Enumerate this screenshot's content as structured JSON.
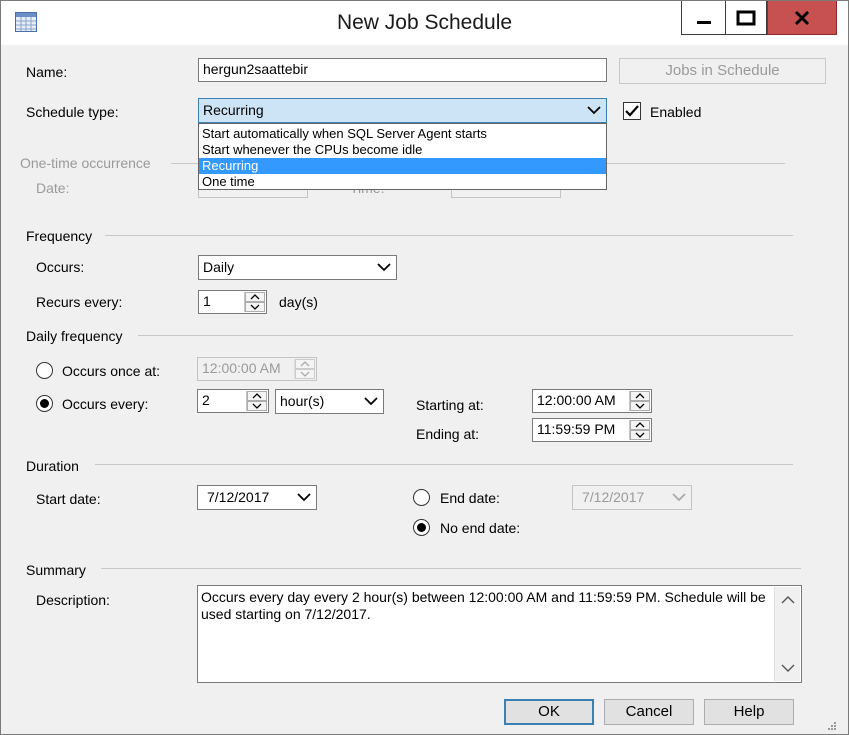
{
  "window": {
    "title": "New Job Schedule",
    "icons": {
      "app": "calendar-grid-icon",
      "minimize": "minimize-icon",
      "maximize": "maximize-icon",
      "close": "close-icon"
    }
  },
  "name": {
    "label": "Name:",
    "value": "hergun2saattebir"
  },
  "jobs_button": "Jobs in Schedule",
  "schedule_type": {
    "label": "Schedule type:",
    "value": "Recurring",
    "options": [
      "Start automatically when SQL Server Agent starts",
      "Start whenever the CPUs become idle",
      "Recurring",
      "One time"
    ],
    "selected_index": 2
  },
  "enabled": {
    "label": "Enabled",
    "checked": true
  },
  "one_time": {
    "heading": "One-time occurrence",
    "date_label": "Date:",
    "time_label": "Time:"
  },
  "frequency": {
    "heading": "Frequency",
    "occurs_label": "Occurs:",
    "occurs_value": "Daily",
    "recurs_label": "Recurs every:",
    "recurs_value": "1",
    "recurs_unit": "day(s)"
  },
  "daily": {
    "heading": "Daily frequency",
    "once_label": "Occurs once at:",
    "once_value": "12:00:00 AM",
    "every_label": "Occurs every:",
    "every_value": "2",
    "every_unit": "hour(s)",
    "starting_label": "Starting at:",
    "starting_value": "12:00:00 AM",
    "ending_label": "Ending at:",
    "ending_value": "11:59:59 PM",
    "selected": "every"
  },
  "duration": {
    "heading": "Duration",
    "start_label": "Start date:",
    "start_value": "7/12/2017",
    "end_label": "End date:",
    "end_value": "7/12/2017",
    "no_end_label": "No end date:",
    "selected": "no_end"
  },
  "summary": {
    "heading": "Summary",
    "description_label": "Description:",
    "description": "Occurs every day every 2 hour(s) between 12:00:00 AM and 11:59:59 PM. Schedule will be used starting on 7/12/2017."
  },
  "buttons": {
    "ok": "OK",
    "cancel": "Cancel",
    "help": "Help"
  },
  "colors": {
    "close_button": "#c75050",
    "selection": "#3399ff",
    "active_combo": "#cde4f7"
  }
}
